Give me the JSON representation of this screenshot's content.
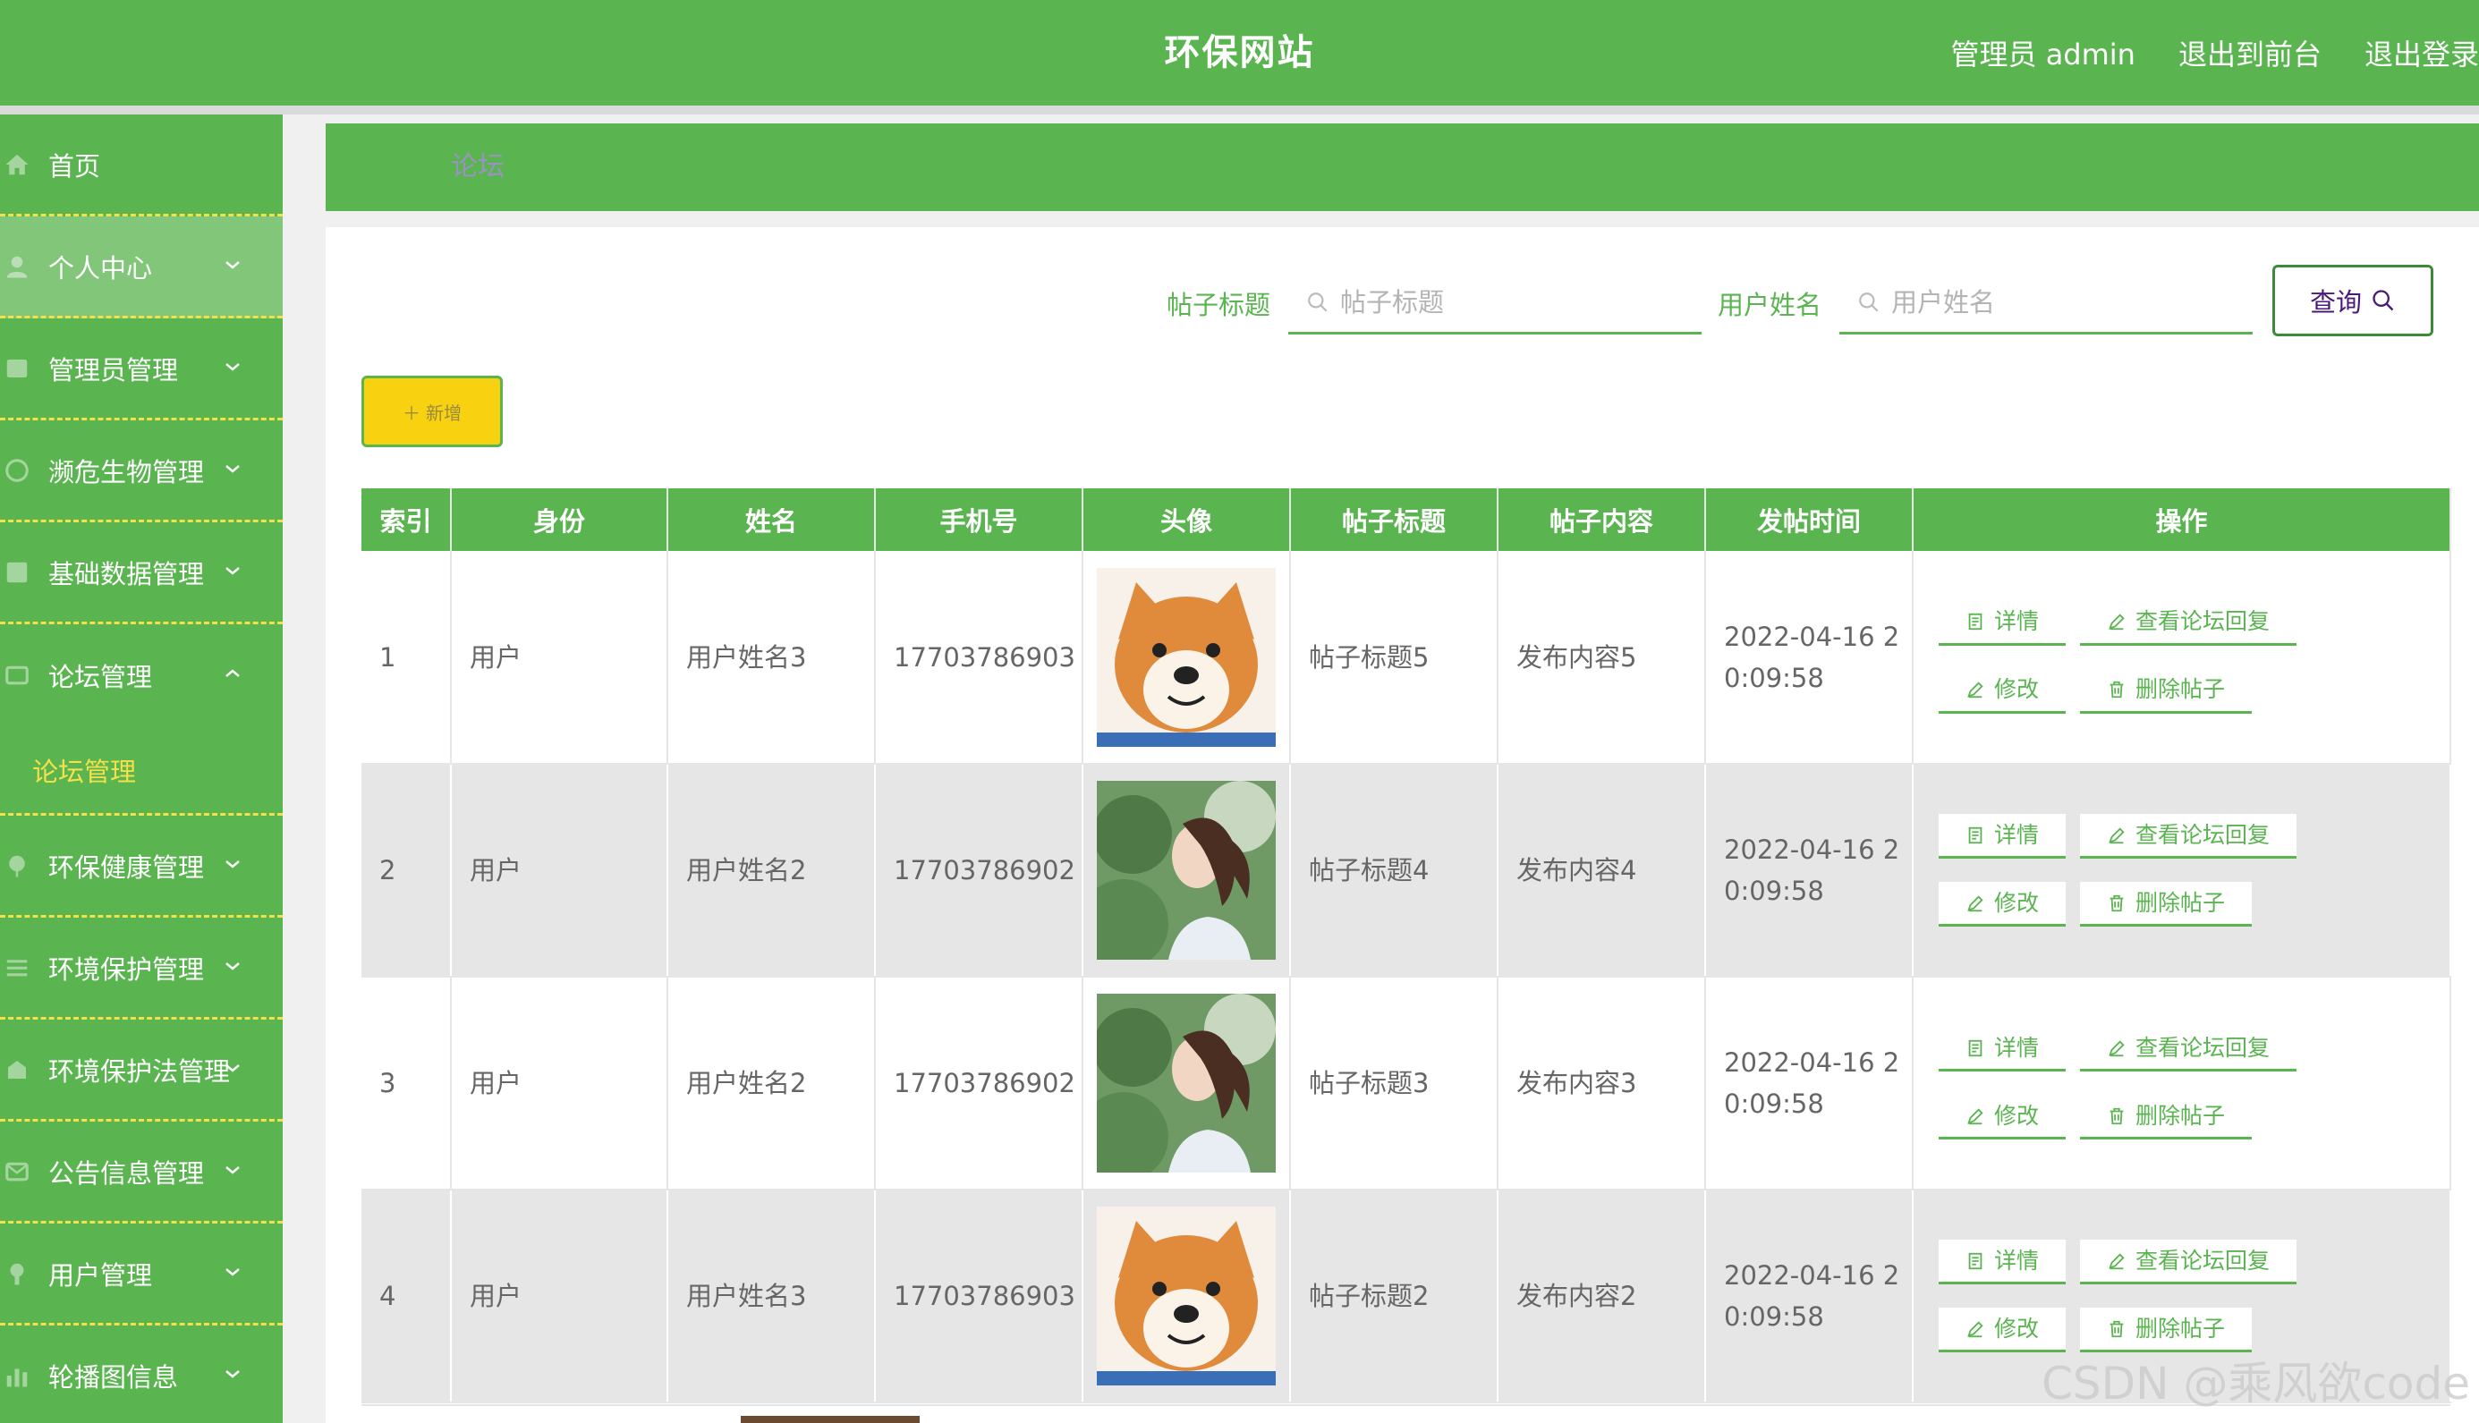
{
  "header": {
    "title": "环保网站",
    "admin_label": "管理员 admin",
    "front_label": "退出到前台",
    "logout_label": "退出登录"
  },
  "sidebar": {
    "items": [
      {
        "label": "首页",
        "icon": "home-icon"
      },
      {
        "label": "个人中心",
        "icon": "user-icon",
        "active": true
      },
      {
        "label": "管理员管理",
        "icon": "admin-icon"
      },
      {
        "label": "濒危生物管理",
        "icon": "globe-icon"
      },
      {
        "label": "基础数据管理",
        "icon": "grid-icon"
      },
      {
        "label": "论坛管理",
        "icon": "forum-icon",
        "expanded": true
      },
      {
        "label": "环保健康管理",
        "icon": "leaf-icon"
      },
      {
        "label": "环境保护管理",
        "icon": "list-icon"
      },
      {
        "label": "环境保护法管理",
        "icon": "law-icon"
      },
      {
        "label": "公告信息管理",
        "icon": "notice-icon"
      },
      {
        "label": "用户管理",
        "icon": "users-icon"
      },
      {
        "label": "轮播图信息",
        "icon": "chart-icon"
      }
    ],
    "sub_item": "论坛管理"
  },
  "breadcrumb": "论坛",
  "search": {
    "title_label": "帖子标题",
    "title_placeholder": "帖子标题",
    "name_label": "用户姓名",
    "name_placeholder": "用户姓名",
    "query_button": "查询"
  },
  "add_button": "新增",
  "table": {
    "headers": [
      "索引",
      "身份",
      "姓名",
      "手机号",
      "头像",
      "帖子标题",
      "帖子内容",
      "发帖时间",
      "操作"
    ],
    "rows": [
      {
        "index": "1",
        "role": "用户",
        "name": "用户姓名3",
        "phone": "17703786903",
        "avatar": "shiba",
        "title": "帖子标题5",
        "content": "发布内容5",
        "time_line1": "2022-04-16 2",
        "time_line2": "0:09:58"
      },
      {
        "index": "2",
        "role": "用户",
        "name": "用户姓名2",
        "phone": "17703786902",
        "avatar": "girl",
        "title": "帖子标题4",
        "content": "发布内容4",
        "time_line1": "2022-04-16 2",
        "time_line2": "0:09:58"
      },
      {
        "index": "3",
        "role": "用户",
        "name": "用户姓名2",
        "phone": "17703786902",
        "avatar": "girl",
        "title": "帖子标题3",
        "content": "发布内容3",
        "time_line1": "2022-04-16 2",
        "time_line2": "0:09:58"
      },
      {
        "index": "4",
        "role": "用户",
        "name": "用户姓名3",
        "phone": "17703786903",
        "avatar": "shiba",
        "title": "帖子标题2",
        "content": "发布内容2",
        "time_line1": "2022-04-16 2",
        "time_line2": "0:09:58"
      }
    ],
    "actions": {
      "detail": "详情",
      "view_reply": "查看论坛回复",
      "edit": "修改",
      "delete": "删除帖子"
    }
  },
  "watermark": "CSDN @乘风欲code",
  "colors": {
    "primary": "#5ab450",
    "accent_yellow": "#f5e04a",
    "add_button": "#f8d210"
  }
}
